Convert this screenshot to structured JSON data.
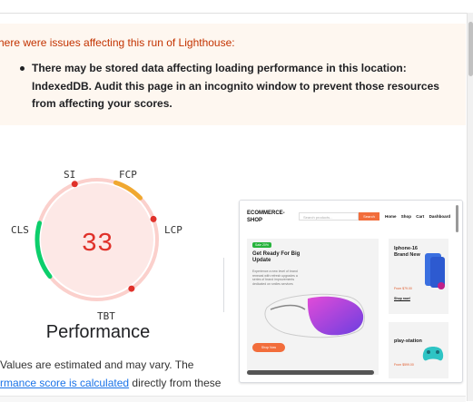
{
  "warning": {
    "title": "here were issues affecting this run of Lighthouse:",
    "items": [
      "There may be stored data affecting loading performance in this location: IndexedDB. Audit this page in an incognito window to prevent those resources from affecting your scores."
    ]
  },
  "gauge": {
    "score": "33",
    "score_fraction": 0.33,
    "metrics": {
      "si": "SI",
      "fcp": "FCP",
      "lcp": "LCP",
      "tbt": "TBT",
      "cls": "CLS"
    },
    "title": "Performance",
    "colors": {
      "fail": "#e0312a",
      "average": "#f0a830",
      "pass": "#0cce6b",
      "track": "#fbd0cc",
      "fill": "#fde8e6"
    }
  },
  "disclaimer": {
    "line1": "Values are estimated and may vary. The",
    "link": "rmance score is calculated",
    "line2_rest": " directly from these"
  },
  "screenshot": {
    "logo": "ECOMMERCE-\nSHOP",
    "search_placeholder": "Search products...",
    "search_button": "Search",
    "nav": [
      "Home",
      "Shop",
      "Cart",
      "Dashboard"
    ],
    "hero": {
      "badge": "Sale 20%",
      "title": "Get Ready For Big Update",
      "desc": "Experience a new level of brand renewal with refresh upgrades a series of brand improvements dedicated on smiles services",
      "button": "Shop Now"
    },
    "products": [
      {
        "name": "Iphone-16 Brand New",
        "price": "From $79.00",
        "link": "Shop now!"
      },
      {
        "name": "play-station",
        "price": "From $599.00",
        "link": ""
      }
    ]
  }
}
